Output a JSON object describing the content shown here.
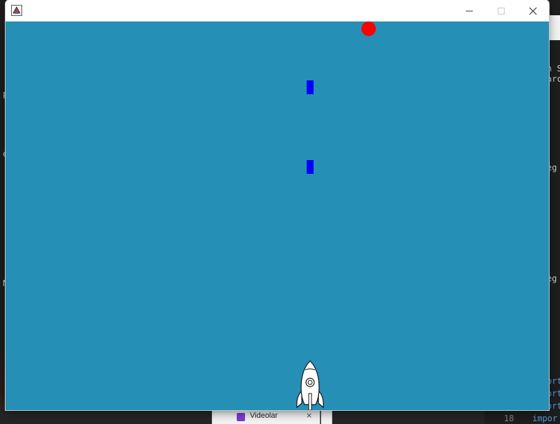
{
  "window": {
    "title": "",
    "controls": {
      "minimize_icon": "minimize-icon",
      "maximize_icon": "maximize-icon",
      "close_icon": "close-icon"
    }
  },
  "game": {
    "background_color": "#268fb5",
    "enemy": {
      "shape": "circle",
      "color": "#ff0000"
    },
    "bullets": [
      {
        "color": "#0000ff"
      },
      {
        "color": "#0000ff"
      }
    ],
    "player": {
      "sprite": "rocket-icon",
      "color": "#ffffff"
    }
  },
  "background": {
    "left_fragments": [
      "P",
      "e",
      "N"
    ],
    "right_fragments": [
      "n S",
      "arc",
      "eg",
      "eg"
    ],
    "code_fragments": [
      "ort",
      "ort",
      "ort"
    ],
    "taskbar_tab": {
      "label": "Videolar",
      "close": "×"
    },
    "editor": {
      "line_number": "18",
      "code": "impor"
    }
  }
}
